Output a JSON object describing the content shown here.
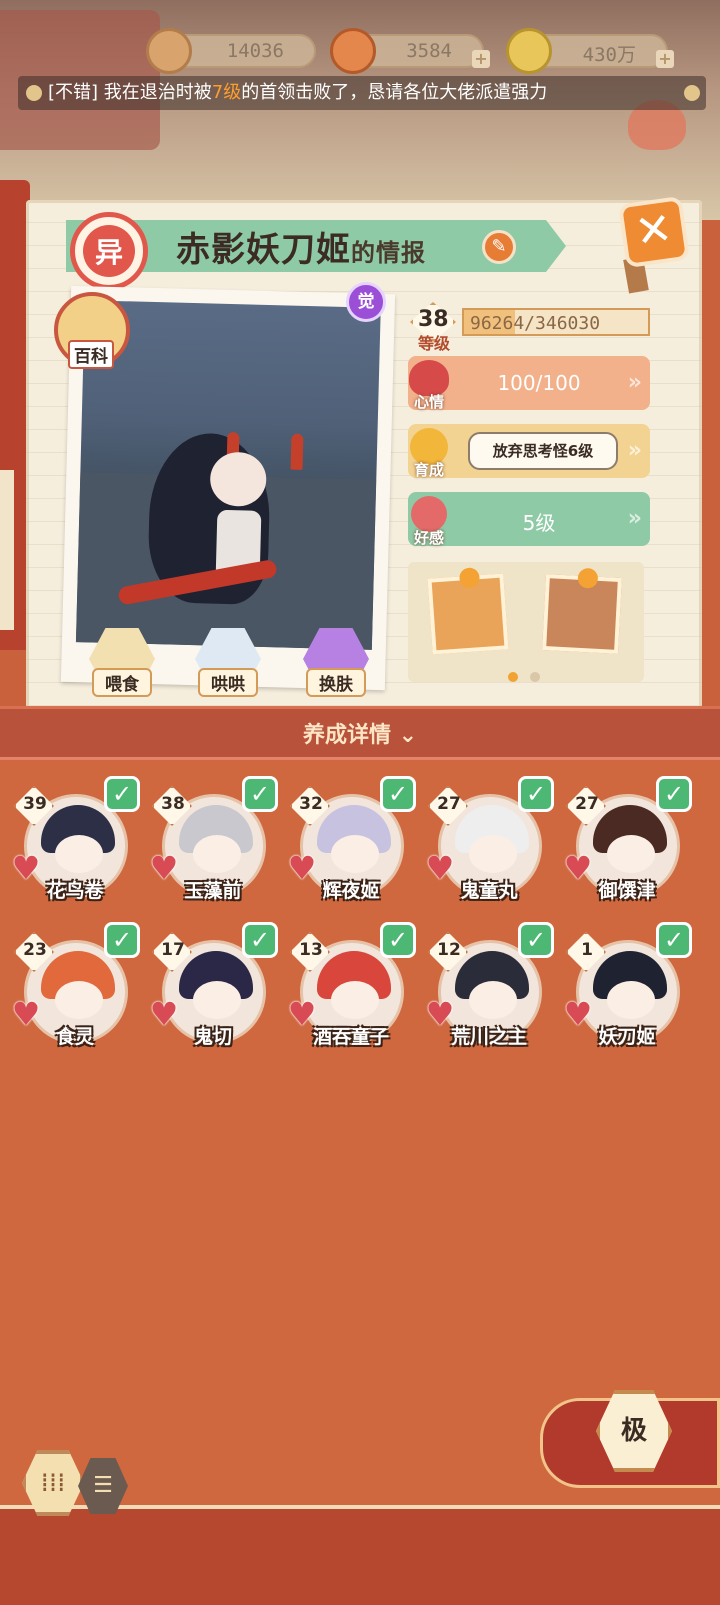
{
  "resources": [
    {
      "icon": "jade-icon",
      "value": "14036"
    },
    {
      "icon": "stamina-icon",
      "value": "3584"
    },
    {
      "icon": "coin-icon",
      "value": "430万"
    }
  ],
  "ticker": {
    "prefix": "[不错] 我在退治时被",
    "highlight": "7级",
    "suffix": "的首领击败了，恳请各位大佬派遣强力"
  },
  "title": {
    "badge": "异",
    "name": "赤影妖刀姬",
    "suffix": "的情报"
  },
  "photo": {
    "wiki_label": "百科",
    "awaken_badge": "觉"
  },
  "actions": [
    {
      "icon": "bowl-icon",
      "label": "喂食"
    },
    {
      "icon": "milk-icon",
      "label": "哄哄"
    },
    {
      "icon": "skin-icon",
      "label": "换肤"
    }
  ],
  "stats": {
    "level": "38",
    "level_label": "等级",
    "exp": "96264/346030",
    "exp_fraction": 0.278,
    "mood_label": "心情",
    "mood": "100/100",
    "training_label": "育成",
    "training": "放弃思考怪6级",
    "affection_label": "好感",
    "affection": "5级"
  },
  "roster_header": "养成详情",
  "roster": [
    {
      "level": "39",
      "name": "花鸟卷",
      "hair": "#2c2f45"
    },
    {
      "level": "38",
      "name": "玉藻前",
      "hair": "#c9c8cf"
    },
    {
      "level": "32",
      "name": "辉夜姬",
      "hair": "#c6c2df"
    },
    {
      "level": "27",
      "name": "鬼童丸",
      "hair": "#eeeeee"
    },
    {
      "level": "27",
      "name": "御馔津",
      "hair": "#4a2a22"
    },
    {
      "level": "23",
      "name": "食灵",
      "hair": "#e2693c"
    },
    {
      "level": "17",
      "name": "鬼切",
      "hair": "#2a2846"
    },
    {
      "level": "13",
      "name": "酒吞童子",
      "hair": "#d8463c"
    },
    {
      "level": "12",
      "name": "荒川之主",
      "hair": "#2b2c3a"
    },
    {
      "level": "1",
      "name": "妖刀姬",
      "hair": "#1f2230"
    }
  ],
  "ultra_label": "极",
  "colors": {
    "check": "#4cb874",
    "mood_row": "#f2b08b",
    "training_row": "#f3d391",
    "affection_row": "#8fcaa6"
  }
}
